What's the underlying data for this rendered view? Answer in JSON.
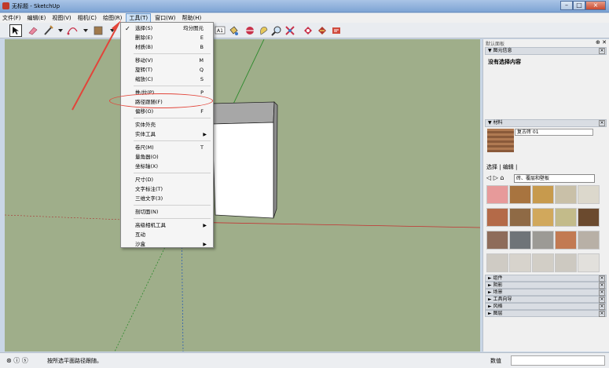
{
  "window": {
    "title": "无标题 - SketchUp"
  },
  "menubar": [
    "文件(F)",
    "编辑(E)",
    "视图(V)",
    "相机(C)",
    "绘图(R)",
    "工具(T)",
    "窗口(W)",
    "帮助(H)"
  ],
  "tools_menu": {
    "groups": [
      [
        {
          "label": "选择(S)",
          "shortcut": "均分图元",
          "checked": true
        },
        {
          "label": "删除(E)",
          "shortcut": "E"
        },
        {
          "label": "材质(B)",
          "shortcut": "B"
        }
      ],
      [
        {
          "label": "移动(V)",
          "shortcut": "M"
        },
        {
          "label": "旋转(T)",
          "shortcut": "Q"
        },
        {
          "label": "缩放(C)",
          "shortcut": "S"
        }
      ],
      [
        {
          "label": "推/拉(P)",
          "shortcut": "P"
        },
        {
          "label": "路径跟随(F)",
          "shortcut": "",
          "highlight": true
        },
        {
          "label": "偏移(O)",
          "shortcut": "F"
        }
      ],
      [
        {
          "label": "实体外壳",
          "shortcut": ""
        },
        {
          "label": "实体工具",
          "shortcut": "",
          "submenu": true
        }
      ],
      [
        {
          "label": "卷尺(M)",
          "shortcut": "T"
        },
        {
          "label": "量角器(O)",
          "shortcut": ""
        },
        {
          "label": "坐标轴(X)",
          "shortcut": ""
        }
      ],
      [
        {
          "label": "尺寸(D)",
          "shortcut": ""
        },
        {
          "label": "文字标注(T)",
          "shortcut": ""
        },
        {
          "label": "三维文字(3)",
          "shortcut": ""
        }
      ],
      [
        {
          "label": "剖切面(N)",
          "shortcut": ""
        }
      ],
      [
        {
          "label": "高级相机工具",
          "shortcut": "",
          "submenu": true
        },
        {
          "label": "互动",
          "shortcut": ""
        },
        {
          "label": "沙盒",
          "shortcut": "",
          "submenu": true
        }
      ]
    ]
  },
  "tray": {
    "title": "默认面板",
    "entity_info": {
      "header": "图元信息",
      "text": "没有选择内容"
    },
    "materials": {
      "header": "材料",
      "name": "复古砖 01",
      "tabs": [
        "选择",
        "编辑"
      ],
      "collection": "砖、覆层和壁板"
    },
    "collapsed": [
      "组件",
      "阴影",
      "场景",
      "工具向导",
      "风格",
      "图层"
    ]
  },
  "status": {
    "text": "按所选平面路径跟随。",
    "value_label": "数值"
  },
  "colors": {
    "canvas": "#9fae8a",
    "highlight": "#e2453a",
    "menu_active": "#cfe3f7"
  },
  "swatches": [
    "#e79a9a",
    "#a8743f",
    "#c79a4d",
    "#c9c0a8",
    "#dcd8cc",
    "#b46a48",
    "#8f6a45",
    "#d1a85c",
    "#c3bb8a",
    "#6b4a2e",
    "#8e6c5a",
    "#6f7478",
    "#9c9a95",
    "#c27a52",
    "#b8b0a6",
    "#cfcbc4",
    "#d7d3cc",
    "#d2cec6",
    "#cdc9c1",
    "#e2e0dc"
  ]
}
